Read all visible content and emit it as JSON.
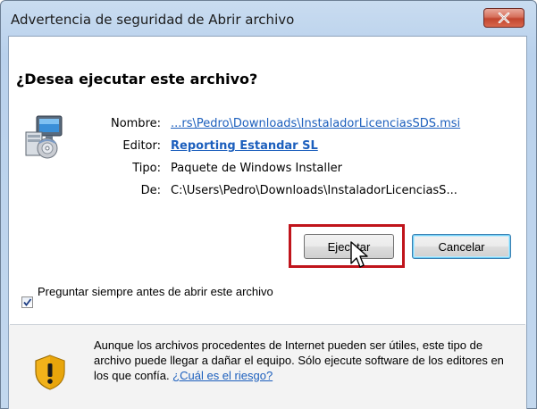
{
  "window": {
    "title": "Advertencia de seguridad de Abrir archivo",
    "close_icon": "close-icon"
  },
  "dialog": {
    "question": "¿Desea ejecutar este archivo?",
    "file_icon": "installer-package-icon",
    "fields": [
      {
        "label": "Nombre:",
        "value": "...rs\\Pedro\\Downloads\\InstaladorLicenciasSDS.msi",
        "is_link": true
      },
      {
        "label": "Editor:",
        "value": "Reporting Estandar SL",
        "is_link": true
      },
      {
        "label": "Tipo:",
        "value": "Paquete de Windows Installer",
        "is_link": false
      },
      {
        "label": "De:",
        "value": "C:\\Users\\Pedro\\Downloads\\InstaladorLicenciasS...",
        "is_link": false
      }
    ],
    "buttons": {
      "run": "Ejecutar",
      "cancel": "Cancelar"
    },
    "checkbox": {
      "label": "Preguntar siempre antes de abrir este archivo",
      "checked": true
    },
    "warning": {
      "icon": "security-shield-icon",
      "text": "Aunque los archivos procedentes de Internet pueden ser útiles, este tipo de archivo puede llegar a dañar el equipo. Sólo ejecute software de los editores en los que confía. ",
      "link": "¿Cuál es el riesgo?"
    }
  },
  "colors": {
    "highlight": "#c0141b",
    "link": "#1c5fbd",
    "titlebar": "#b9d1ec"
  }
}
